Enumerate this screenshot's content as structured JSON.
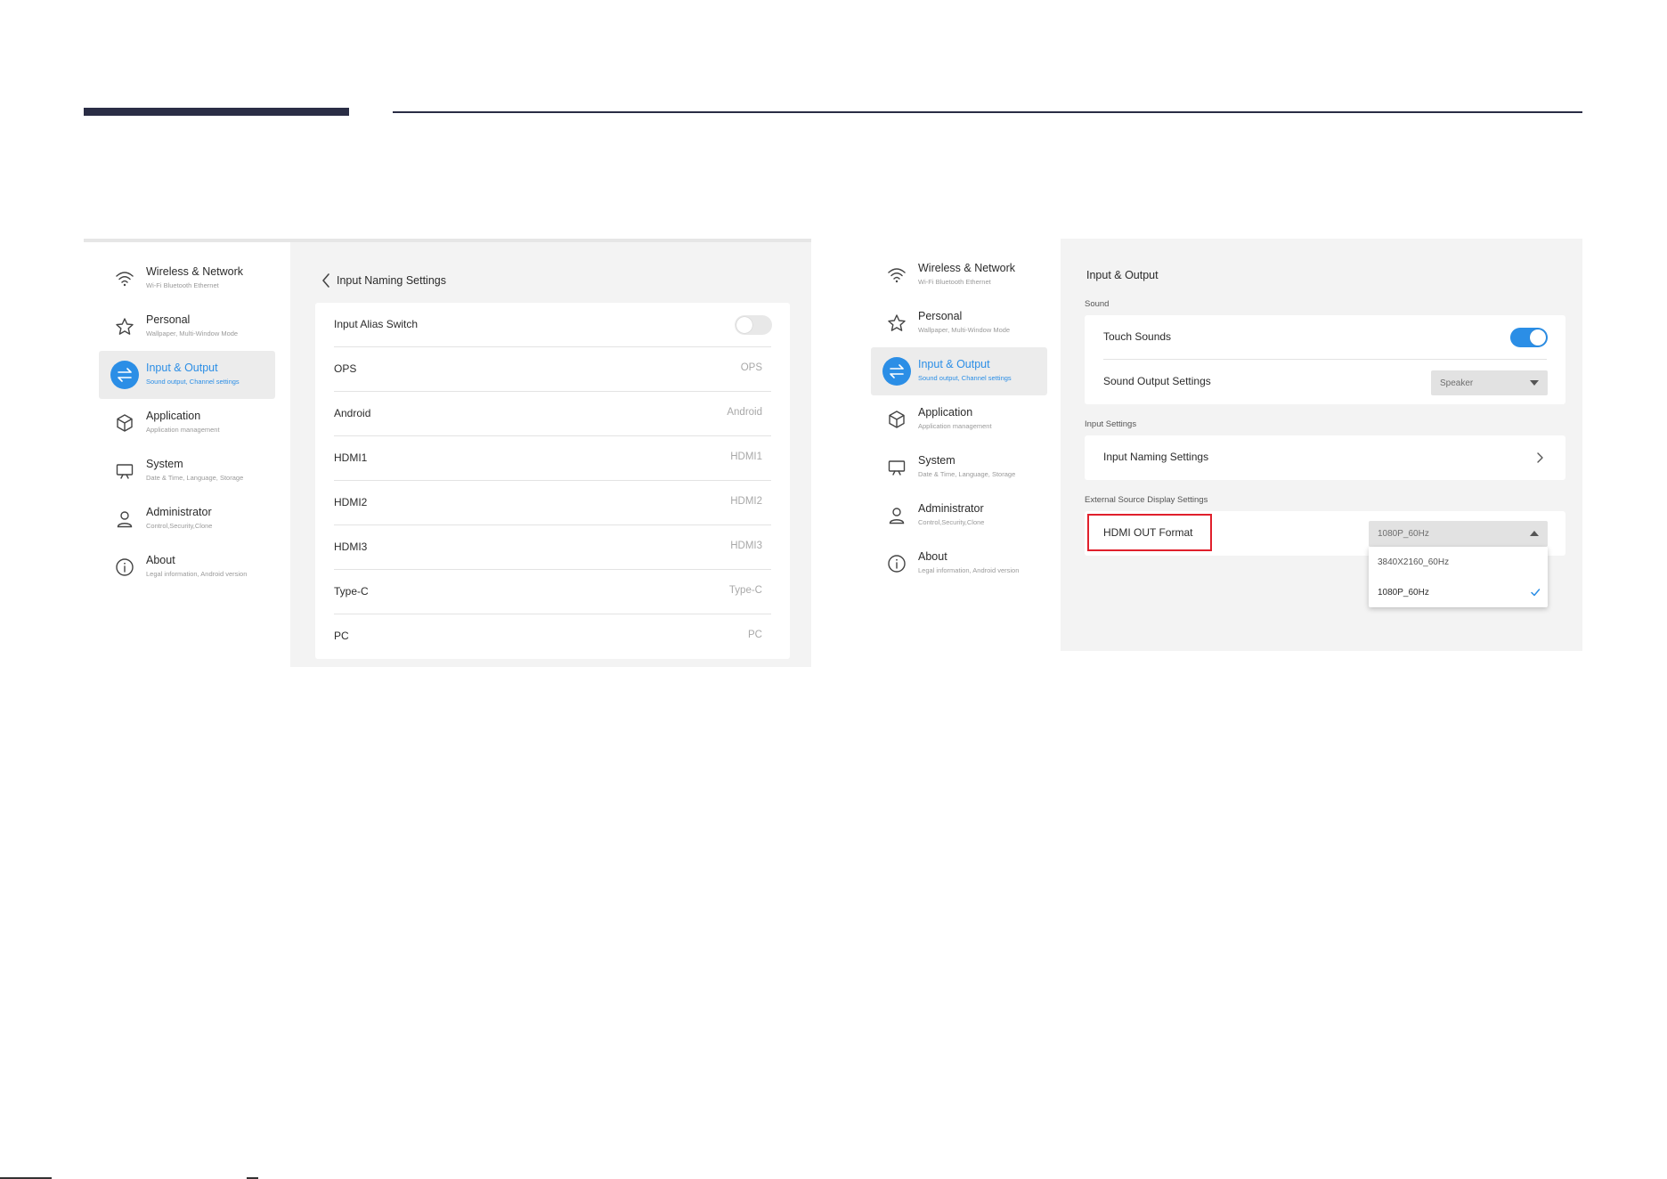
{
  "colors": {
    "accent": "#2b8ee6",
    "header_rule": "#2a2d45",
    "highlight": "#e0202c"
  },
  "left_screen": {
    "sidebar": [
      {
        "title": "Wireless & Network",
        "subtitle": "Wi-Fi Bluetooth Ethernet",
        "icon": "wifi-icon"
      },
      {
        "title": "Personal",
        "subtitle": "Wallpaper, Multi-Window Mode",
        "icon": "star-icon"
      },
      {
        "title": "Input & Output",
        "subtitle": "Sound output, Channel settings",
        "icon": "swap-arrows-icon",
        "active": true
      },
      {
        "title": "Application",
        "subtitle": "Application management",
        "icon": "cube-icon"
      },
      {
        "title": "System",
        "subtitle": "Date & Time, Language, Storage",
        "icon": "monitor-icon"
      },
      {
        "title": "Administrator",
        "subtitle": "Control,Security,Clone",
        "icon": "person-icon"
      },
      {
        "title": "About",
        "subtitle": "Legal information, Android version",
        "icon": "info-icon"
      }
    ],
    "page_title": "Input Naming Settings",
    "alias_switch": {
      "label": "Input Alias Switch",
      "state": "off"
    },
    "inputs": [
      {
        "label": "OPS",
        "value": "OPS"
      },
      {
        "label": "Android",
        "value": "Android"
      },
      {
        "label": "HDMI1",
        "value": "HDMI1"
      },
      {
        "label": "HDMI2",
        "value": "HDMI2"
      },
      {
        "label": "HDMI3",
        "value": "HDMI3"
      },
      {
        "label": "Type-C",
        "value": "Type-C"
      },
      {
        "label": "PC",
        "value": "PC"
      }
    ]
  },
  "right_screen": {
    "sidebar": [
      {
        "title": "Wireless & Network",
        "subtitle": "Wi-Fi Bluetooth Ethernet",
        "icon": "wifi-icon"
      },
      {
        "title": "Personal",
        "subtitle": "Wallpaper, Multi-Window Mode",
        "icon": "star-icon"
      },
      {
        "title": "Input & Output",
        "subtitle": "Sound output, Channel settings",
        "icon": "swap-arrows-icon",
        "active": true
      },
      {
        "title": "Application",
        "subtitle": "Application management",
        "icon": "cube-icon"
      },
      {
        "title": "System",
        "subtitle": "Date & Time, Language, Storage",
        "icon": "monitor-icon"
      },
      {
        "title": "Administrator",
        "subtitle": "Control,Security,Clone",
        "icon": "person-icon"
      },
      {
        "title": "About",
        "subtitle": "Legal information, Android version",
        "icon": "info-icon"
      }
    ],
    "page_title": "Input & Output",
    "sound": {
      "section_label": "Sound",
      "touch_sounds": {
        "label": "Touch Sounds",
        "state": "on"
      },
      "sound_output": {
        "label": "Sound Output Settings",
        "value": "Speaker"
      }
    },
    "input_settings": {
      "section_label": "Input Settings",
      "input_naming": {
        "label": "Input Naming Settings"
      }
    },
    "external_source": {
      "section_label": "External Source Display Settings",
      "hdmi_out": {
        "label": "HDMI OUT Format",
        "value": "1080P_60Hz",
        "options": [
          {
            "label": "3840X2160_60Hz",
            "selected": false
          },
          {
            "label": "1080P_60Hz",
            "selected": true
          }
        ]
      }
    }
  }
}
